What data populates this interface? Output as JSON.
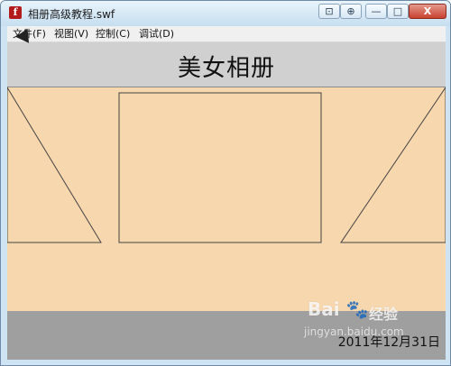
{
  "window": {
    "title": "相册高级教程.swf",
    "app_icon": "flash-icon",
    "buttons": {
      "extra1": "⊡",
      "extra2": "⊕",
      "minimize": "—",
      "maximize": "□",
      "close": "X"
    }
  },
  "menu": [
    {
      "label": "文件(F)"
    },
    {
      "label": "视图(V)"
    },
    {
      "label": "控制(C)"
    },
    {
      "label": "调试(D)"
    }
  ],
  "stage": {
    "title": "美女相册",
    "date": "2011年12月31日"
  },
  "watermark": {
    "logo": "Bai 🐾",
    "sub": "经验",
    "url": "jingyan.baidu.com"
  },
  "colors": {
    "stage_bg": "#f7d7ad",
    "header_band": "#d0d0d0",
    "footer_band": "#9f9f9f",
    "close_button": "#c8412e"
  }
}
